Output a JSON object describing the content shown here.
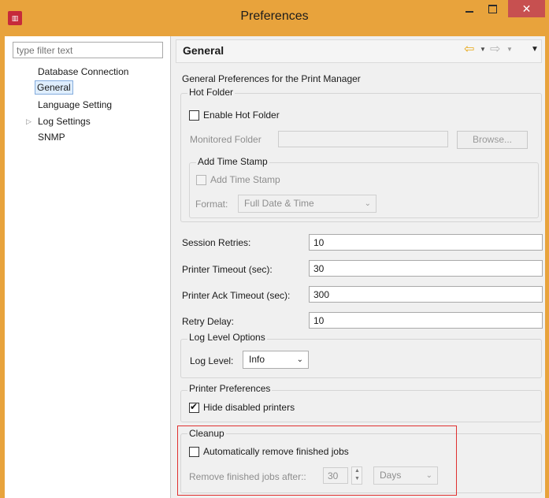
{
  "window": {
    "title": "Preferences",
    "close_glyph": "✕"
  },
  "tree": {
    "filter_placeholder": "type filter text",
    "items": [
      {
        "label": "Database Connection"
      },
      {
        "label": "General",
        "selected": true
      },
      {
        "label": "Language Setting"
      },
      {
        "label": "Log Settings",
        "expandable": true
      },
      {
        "label": "SNMP"
      }
    ]
  },
  "page": {
    "title": "General",
    "description": "General Preferences for the Print Manager",
    "nav_icons": [
      "back-arrow-icon",
      "dropdown-icon",
      "forward-arrow-icon",
      "dropdown-icon",
      "view-menu-icon"
    ]
  },
  "hot_folder": {
    "group_label": "Hot Folder",
    "enable_label": "Enable Hot Folder",
    "enable_checked": false,
    "monitored_label": "Monitored Folder",
    "monitored_value": "",
    "browse_label": "Browse...",
    "time_stamp": {
      "group_label": "Add Time Stamp",
      "checkbox_label": "Add Time Stamp",
      "checked": false,
      "format_label": "Format:",
      "format_value": "Full Date & Time"
    }
  },
  "settings": {
    "session_retries": {
      "label": "Session Retries:",
      "value": "10"
    },
    "printer_timeout": {
      "label": "Printer Timeout (sec):",
      "value": "30"
    },
    "printer_ack_timeout": {
      "label": "Printer Ack Timeout (sec):",
      "value": "300"
    },
    "retry_delay": {
      "label": "Retry Delay:",
      "value": "10"
    }
  },
  "log_level": {
    "group_label": "Log Level Options",
    "label": "Log Level:",
    "value": "Info"
  },
  "printer_prefs": {
    "group_label": "Printer Preferences",
    "hide_disabled_label": "Hide disabled printers",
    "hide_disabled_checked": true
  },
  "cleanup": {
    "group_label": "Cleanup",
    "auto_remove_label": "Automatically remove finished jobs",
    "auto_remove_checked": false,
    "remove_after_label": "Remove finished jobs after::",
    "remove_after_value": "30",
    "unit_value": "Days"
  },
  "colors": {
    "title_bar": "#e8a33c",
    "close_button": "#c75050",
    "highlight_border": "#e0302f",
    "tree_selection": "#dfeefd",
    "back_arrow": "#e7a817"
  }
}
